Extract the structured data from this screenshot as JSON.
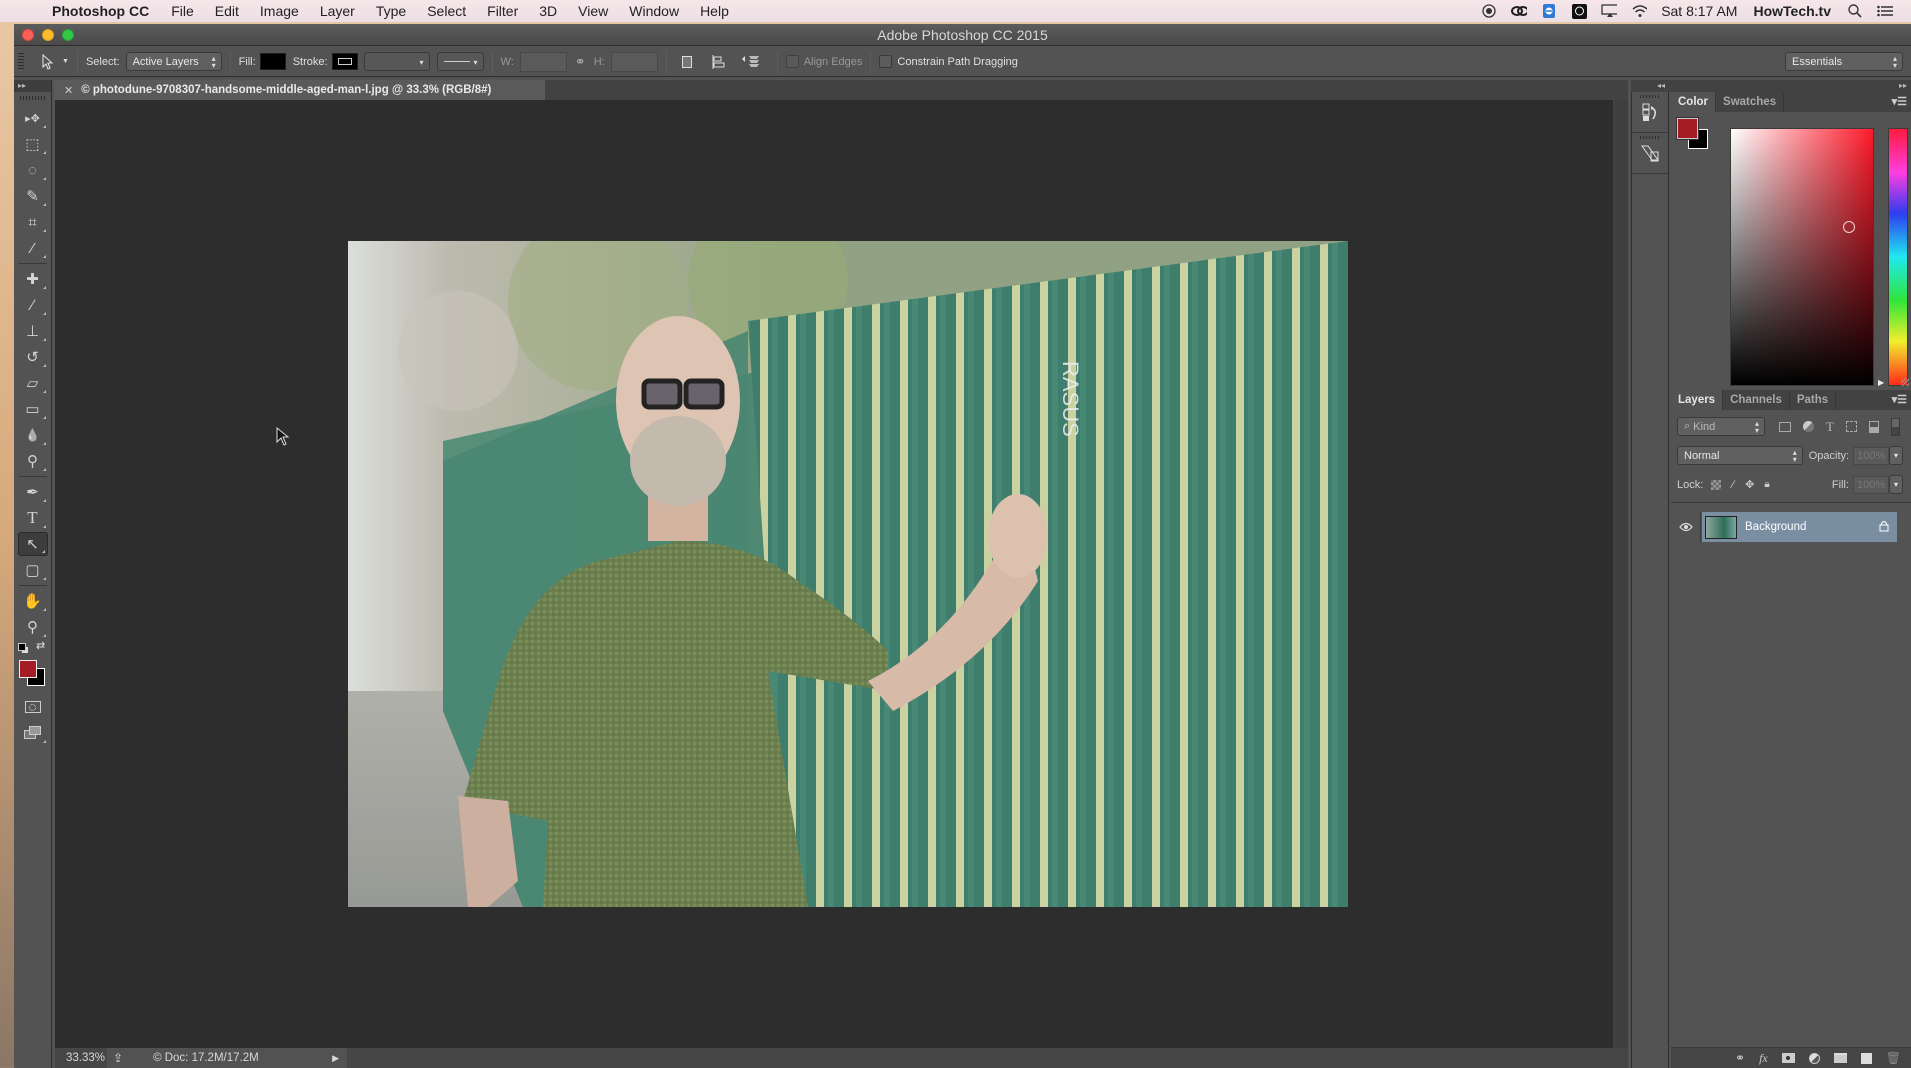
{
  "menubar": {
    "app_name": "Photoshop CC",
    "items": [
      "File",
      "Edit",
      "Image",
      "Layer",
      "Type",
      "Select",
      "Filter",
      "3D",
      "View",
      "Window",
      "Help"
    ],
    "status_icons": [
      "record-icon",
      "creative-cloud-icon",
      "teamviewer-icon",
      "accessibility-icon",
      "airplay-icon",
      "wifi-icon"
    ],
    "clock": "Sat 8:17 AM",
    "user": "HowTech.tv"
  },
  "window": {
    "title": "Adobe Photoshop CC 2015"
  },
  "options_bar": {
    "select_label": "Select:",
    "select_value": "Active Layers",
    "fill_label": "Fill:",
    "fill_color": "#000000",
    "stroke_label": "Stroke:",
    "w_label": "W:",
    "h_label": "H:",
    "w_value": "",
    "h_value": "",
    "align_edges_label": "Align Edges",
    "align_edges_checked": false,
    "constrain_label": "Constrain Path Dragging",
    "constrain_checked": false,
    "workspace": "Essentials"
  },
  "document": {
    "tab_title": "© photodune-9708307-handsome-middle-aged-man-l.jpg @ 33.3% (RGB/8#)",
    "zoom": "33.33%",
    "doc_info": "© Doc: 17.2M/17.2M"
  },
  "tools": [
    {
      "name": "move-tool",
      "glyph": "▸✥"
    },
    {
      "name": "marquee-tool",
      "glyph": "⬚"
    },
    {
      "name": "lasso-tool",
      "glyph": "◌"
    },
    {
      "name": "quick-selection-tool",
      "glyph": "✎"
    },
    {
      "name": "crop-tool",
      "glyph": "⌗"
    },
    {
      "name": "eyedropper-tool",
      "glyph": "⁄"
    },
    {
      "name": "healing-brush-tool",
      "glyph": "✚"
    },
    {
      "name": "brush-tool",
      "glyph": "∕"
    },
    {
      "name": "clone-stamp-tool",
      "glyph": "⊥"
    },
    {
      "name": "history-brush-tool",
      "glyph": "↺"
    },
    {
      "name": "eraser-tool",
      "glyph": "▱"
    },
    {
      "name": "gradient-tool",
      "glyph": "▭"
    },
    {
      "name": "blur-tool",
      "glyph": "💧"
    },
    {
      "name": "dodge-tool",
      "glyph": "⚲"
    },
    {
      "name": "pen-tool",
      "glyph": "✒"
    },
    {
      "name": "type-tool",
      "glyph": "T"
    },
    {
      "name": "path-selection-tool",
      "glyph": "↖"
    },
    {
      "name": "rectangle-tool",
      "glyph": "▢"
    },
    {
      "name": "hand-tool",
      "glyph": "✋"
    },
    {
      "name": "zoom-tool",
      "glyph": "⚲"
    }
  ],
  "active_tool": "path-selection-tool",
  "colors": {
    "foreground": "#a51c24",
    "background": "#000000"
  },
  "color_panel": {
    "tabs": [
      "Color",
      "Swatches"
    ],
    "active_tab": "Color",
    "picker_saturation": 0.82,
    "picker_brightness": 0.62,
    "hue_degrees": 357
  },
  "layers_panel": {
    "tabs": [
      "Layers",
      "Channels",
      "Paths"
    ],
    "active_tab": "Layers",
    "filter_kind": "Kind",
    "blend_mode": "Normal",
    "opacity_label": "Opacity:",
    "opacity": "100%",
    "lock_label": "Lock:",
    "fill_label": "Fill:",
    "fill": "100%",
    "layers": [
      {
        "name": "Background",
        "visible": true,
        "locked": true,
        "selected": true
      }
    ]
  }
}
